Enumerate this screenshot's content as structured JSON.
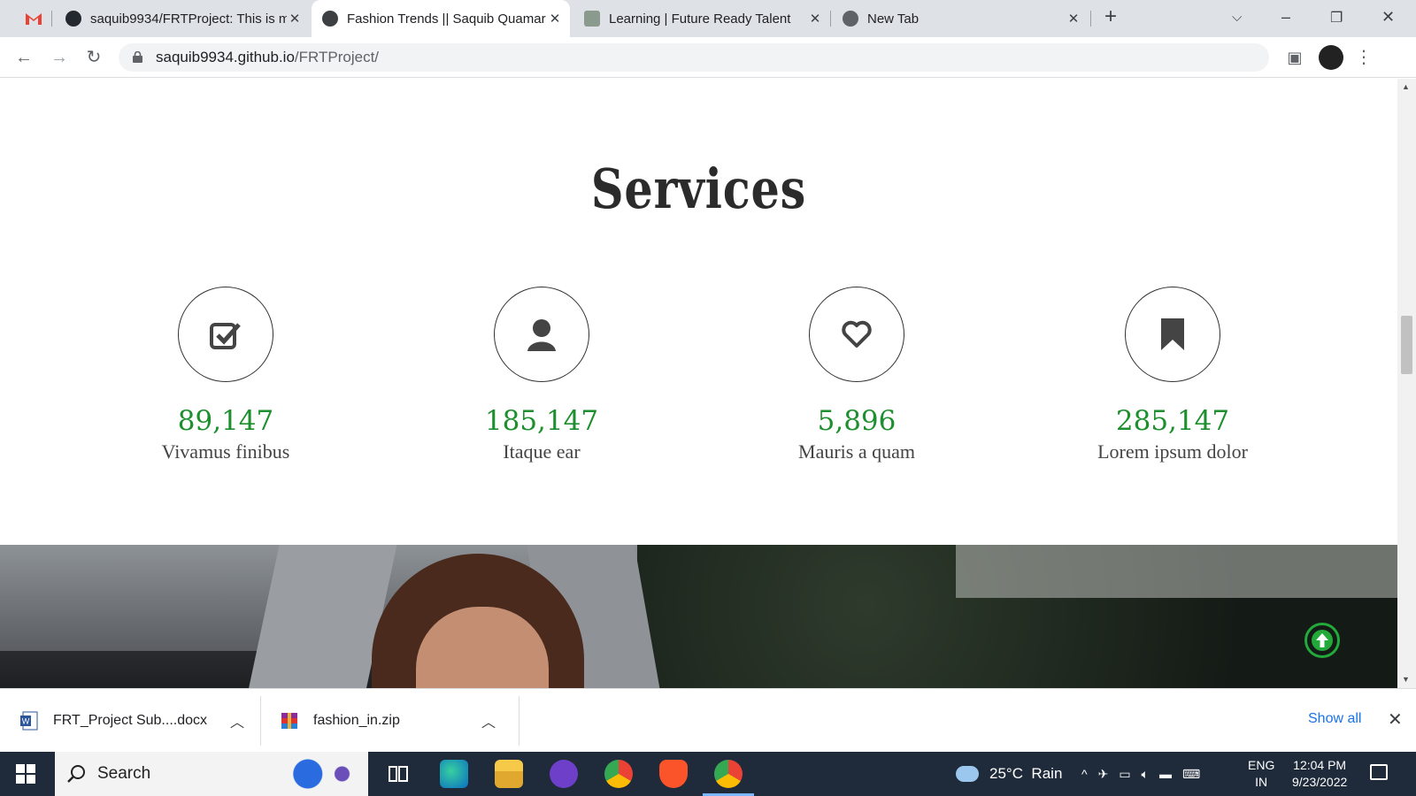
{
  "browser": {
    "tabs": [
      {
        "title": "saquib9934/FRTProject: This is m",
        "favicon": "github-icon",
        "active": false
      },
      {
        "title": "Fashion Trends || Saquib Quamar",
        "favicon": "globe-icon",
        "active": true
      },
      {
        "title": "Learning | Future Ready Talent",
        "favicon": "site-icon",
        "active": false
      },
      {
        "title": "New Tab",
        "favicon": "chrome-icon",
        "active": false
      }
    ],
    "url_domain": "saquib9934.github.io",
    "url_path": "/FRTProject/"
  },
  "page": {
    "services_title": "Services",
    "services": [
      {
        "icon": "check-square-icon",
        "value": "89,147",
        "label": "Vivamus finibus"
      },
      {
        "icon": "user-icon",
        "value": "185,147",
        "label": "Itaque ear"
      },
      {
        "icon": "heart-icon",
        "value": "5,896",
        "label": "Mauris a quam"
      },
      {
        "icon": "bookmark-icon",
        "value": "285,147",
        "label": "Lorem ipsum dolor"
      }
    ],
    "accent_color": "#1e8f2e"
  },
  "downloads": {
    "items": [
      {
        "name": "FRT_Project Sub....docx",
        "icon": "word-doc-icon"
      },
      {
        "name": "fashion_in.zip",
        "icon": "winrar-icon"
      }
    ],
    "show_all_label": "Show all"
  },
  "taskbar": {
    "search_label": "Search",
    "weather": "25°C  Rain",
    "language_line1": "ENG",
    "language_line2": "IN",
    "time": "12:04 PM",
    "date": "9/23/2022"
  }
}
